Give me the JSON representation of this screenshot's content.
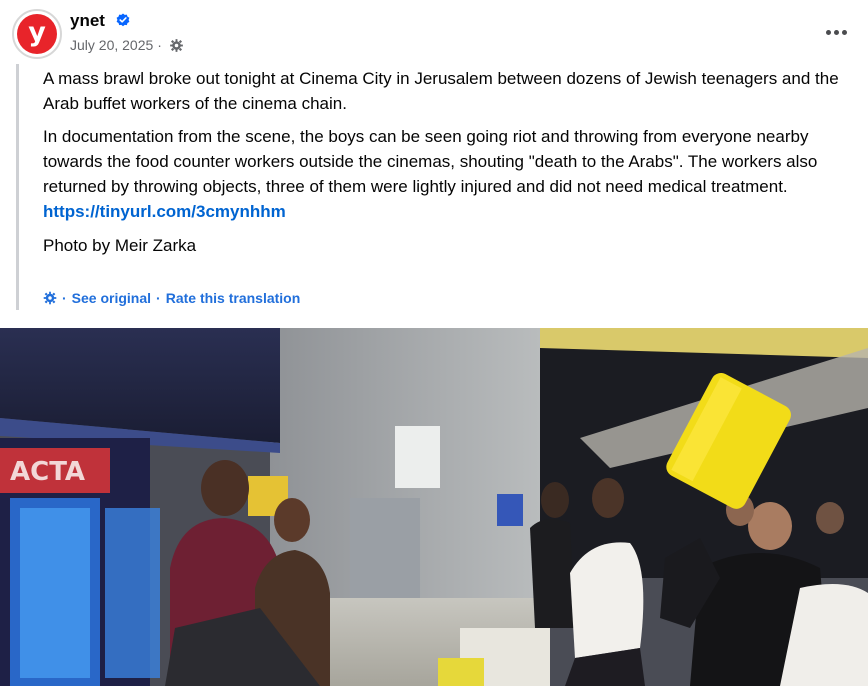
{
  "post": {
    "page_name": "ynet",
    "avatar_letter": "y",
    "date": "July 20, 2025",
    "separator": "·",
    "paragraph_1": "A mass brawl broke out tonight at Cinema City in Jerusalem between dozens of Jewish teenagers and the Arab buffet workers of the cinema chain.",
    "paragraph_2": "In documentation from the scene, the boys can be seen going riot and throwing from everyone nearby towards the food counter workers outside the cinemas, shouting \"death to the Arabs\". The workers also returned by throwing objects, three of them were lightly injured and did not need medical treatment.",
    "link": "https://tinyurl.com/3cmynhhm",
    "credit": "Photo by Meir Zarka",
    "see_original": "See original",
    "rate_translation": "Rate this translation"
  },
  "icons": {
    "verified": "verified-badge-icon",
    "privacy": "globe-gear-icon",
    "more": "more-options-icon",
    "translation": "translation-gear-icon"
  },
  "colors": {
    "brand_red": "#e8242a",
    "link_blue": "#0064d1",
    "meta_gray": "#65676b",
    "quote_border": "#ced0d4"
  },
  "photo_sign_text": "ACTA"
}
